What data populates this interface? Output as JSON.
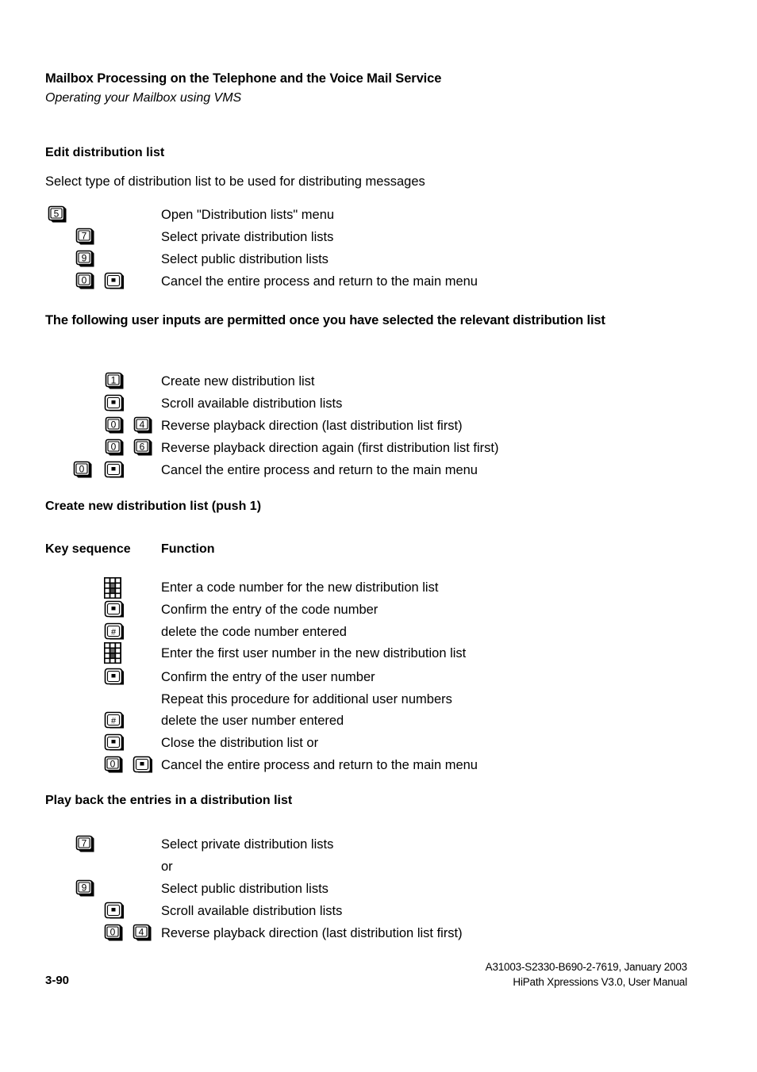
{
  "header": {
    "title": "Mailbox Processing on the Telephone and the Voice Mail Service",
    "subtitle": "Operating your Mailbox using VMS"
  },
  "sections": [
    {
      "heading": "Edit distribution list",
      "intro": "Select type of distribution list to be used for distributing messages",
      "rows": [
        {
          "keys": [
            "5"
          ],
          "text": "Open \"Distribution lists\" menu"
        },
        {
          "keys": [
            "7"
          ],
          "text": "Select private distribution lists"
        },
        {
          "keys": [
            "9"
          ],
          "text": "Select public distribution lists"
        },
        {
          "keys": [
            "0",
            "*"
          ],
          "text": "Cancel the entire process and return to the main menu"
        }
      ]
    },
    {
      "heading": "The following user inputs are permitted once you have selected the relevant distribution list",
      "rows": [
        {
          "keys": [
            "1"
          ],
          "text": "Create new distribution list"
        },
        {
          "keys": [
            "*"
          ],
          "text": "Scroll available distribution lists"
        },
        {
          "keys": [
            "0",
            "4"
          ],
          "text": "Reverse playback direction (last distribution list first)"
        },
        {
          "keys": [
            "0",
            "6"
          ],
          "text": "Reverse playback direction again (first distribution list first)"
        },
        {
          "keys": [
            "0",
            "*"
          ],
          "text": "Cancel the entire process and return to the main menu"
        }
      ]
    },
    {
      "heading": "Create new distribution list (push 1)",
      "col_headers": {
        "keys": "Key sequence",
        "function": "Function"
      },
      "rows": [
        {
          "keys": [
            "keypad"
          ],
          "text": "Enter a code number for the new distribution list"
        },
        {
          "keys": [
            "*"
          ],
          "text": "Confirm the entry of the code number"
        },
        {
          "keys": [
            "#"
          ],
          "text": "delete the code number entered"
        },
        {
          "keys": [
            "keypad"
          ],
          "text": "Enter the first user number in the new distribution list"
        },
        {
          "keys": [
            "*"
          ],
          "text": "Confirm the entry of the user number"
        },
        {
          "keys": [],
          "text": "Repeat this procedure for additional user numbers"
        },
        {
          "keys": [
            "#"
          ],
          "text": "delete the user number entered"
        },
        {
          "keys": [
            "*"
          ],
          "text": "Close the distribution list or"
        },
        {
          "keys": [
            "0",
            "*"
          ],
          "text": "Cancel the entire process and return to the main menu"
        }
      ]
    },
    {
      "heading": "Play back the entries in a distribution list",
      "rows": [
        {
          "keys": [
            "7"
          ],
          "text": "Select private distribution lists"
        },
        {
          "keys": [],
          "text": "or"
        },
        {
          "keys": [
            "9"
          ],
          "text": "Select public distribution lists"
        },
        {
          "keys": [
            "*"
          ],
          "text": "Scroll available distribution lists"
        },
        {
          "keys": [
            "0",
            "4"
          ],
          "text": "Reverse playback direction (last distribution list first)"
        }
      ]
    }
  ],
  "footer": {
    "page_number": "3-90",
    "doc_id": "A31003-S2330-B690-2-7619, January 2003",
    "manual": "HiPath Xpressions V3.0, User Manual"
  },
  "icons": {
    "key_cap": "telephone-key-cap",
    "keypad": "telephone-keypad-icon",
    "star_key": "star-key",
    "hash_key": "hash-key"
  }
}
